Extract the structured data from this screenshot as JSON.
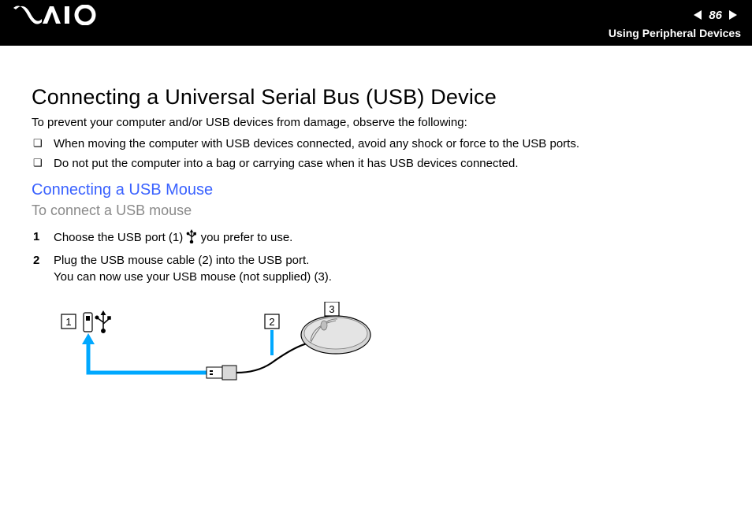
{
  "header": {
    "page_number": "86",
    "section": "Using Peripheral Devices"
  },
  "title": "Connecting a Universal Serial Bus (USB) Device",
  "intro": "To prevent your computer and/or USB devices from damage, observe the following:",
  "bullets": [
    "When moving the computer with USB devices connected, avoid any shock or force to the USB ports.",
    "Do not put the computer into a bag or carrying case when it has USB devices connected."
  ],
  "subheading": "Connecting a USB Mouse",
  "procedure_label": "To connect a USB mouse",
  "steps": [
    {
      "pre": "Choose the USB port (1) ",
      "post": " you prefer to use."
    },
    {
      "pre": "Plug the USB mouse cable (2) into the USB port.\nYou can now use your USB mouse (not supplied) (3).",
      "post": ""
    }
  ],
  "diagram": {
    "labels": {
      "one": "1",
      "two": "2",
      "three": "3"
    }
  }
}
